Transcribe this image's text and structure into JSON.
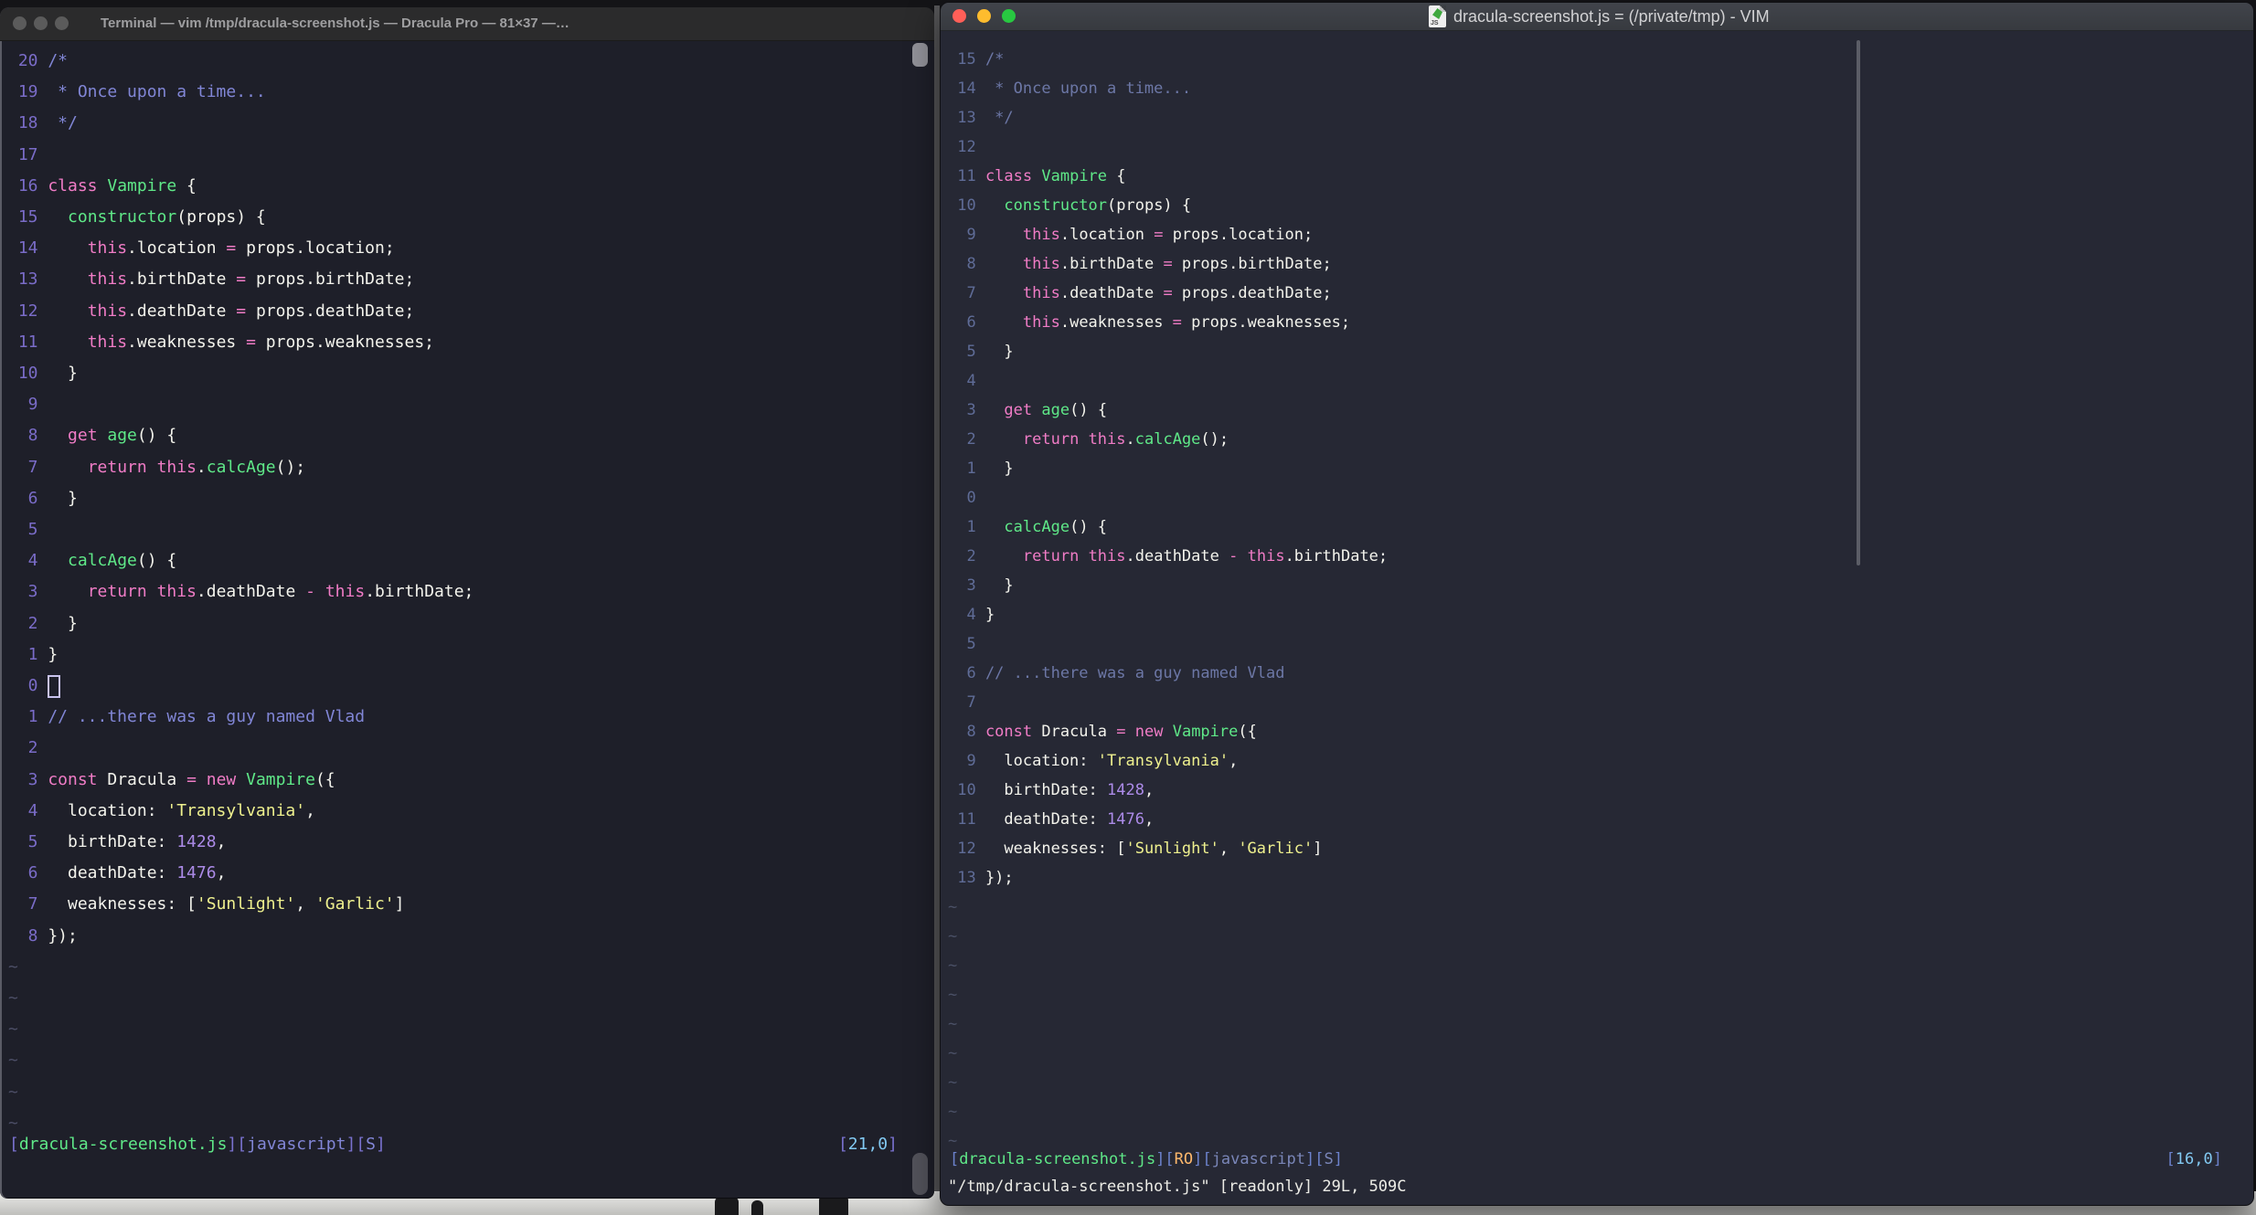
{
  "left_window": {
    "title": "Terminal — vim /tmp/dracula-screenshot.js — Dracula Pro — 81×37 —…",
    "active": false,
    "cursor_rel_index": 20,
    "cursor_position": "21,0",
    "rel_numbers": [
      20,
      19,
      18,
      17,
      16,
      15,
      14,
      13,
      12,
      11,
      10,
      9,
      8,
      7,
      6,
      5,
      4,
      3,
      2,
      1,
      0,
      1,
      2,
      3,
      4,
      5,
      6,
      7,
      8
    ],
    "tilde_count": 6,
    "statusline_segments": [
      [
        "br",
        "["
      ],
      [
        "file",
        "dracula-screenshot.js"
      ],
      [
        "br",
        "]["
      ],
      [
        "label",
        "javascript"
      ],
      [
        "br",
        "]["
      ],
      [
        "label",
        "S"
      ],
      [
        "br",
        "]"
      ]
    ],
    "ruler_segments": [
      [
        "br",
        "["
      ],
      [
        "pos",
        "21,0"
      ],
      [
        "br",
        "]"
      ]
    ]
  },
  "right_window": {
    "title": "dracula-screenshot.js = (/private/tmp) - VIM",
    "icon_label": "JS",
    "active": true,
    "cursor_rel_index": 15,
    "cursor_position": "16,0",
    "rel_numbers": [
      15,
      14,
      13,
      12,
      11,
      10,
      9,
      8,
      7,
      6,
      5,
      4,
      3,
      2,
      1,
      0,
      1,
      2,
      3,
      4,
      5,
      6,
      7,
      8,
      9,
      10,
      11,
      12,
      13
    ],
    "tilde_count": 9,
    "statusline_segments": [
      [
        "br",
        "["
      ],
      [
        "file",
        "dracula-screenshot.js"
      ],
      [
        "br",
        "]["
      ],
      [
        "ro",
        "RO"
      ],
      [
        "br",
        "]["
      ],
      [
        "label",
        "javascript"
      ],
      [
        "br",
        "]["
      ],
      [
        "label",
        "S"
      ],
      [
        "br",
        "]"
      ]
    ],
    "ruler_segments": [
      [
        "br",
        "["
      ],
      [
        "pos",
        "16,0"
      ],
      [
        "br",
        "]"
      ]
    ],
    "message": "\"/tmp/dracula-screenshot.js\" [readonly] 29L, 509C"
  },
  "tilde": "~",
  "code_lines": [
    [
      [
        "c",
        "/*"
      ]
    ],
    [
      [
        "c",
        " * Once upon a time..."
      ]
    ],
    [
      [
        "c",
        " */"
      ]
    ],
    [],
    [
      [
        "p",
        "class"
      ],
      [
        "f",
        " "
      ],
      [
        "g",
        "Vampire"
      ],
      [
        "f",
        " {"
      ]
    ],
    [
      [
        "f",
        "  "
      ],
      [
        "g",
        "constructor"
      ],
      [
        "f",
        "(props) {"
      ]
    ],
    [
      [
        "f",
        "    "
      ],
      [
        "p",
        "this"
      ],
      [
        "f",
        ".location "
      ],
      [
        "p",
        "="
      ],
      [
        "f",
        " props.location;"
      ]
    ],
    [
      [
        "f",
        "    "
      ],
      [
        "p",
        "this"
      ],
      [
        "f",
        ".birthDate "
      ],
      [
        "p",
        "="
      ],
      [
        "f",
        " props.birthDate;"
      ]
    ],
    [
      [
        "f",
        "    "
      ],
      [
        "p",
        "this"
      ],
      [
        "f",
        ".deathDate "
      ],
      [
        "p",
        "="
      ],
      [
        "f",
        " props.deathDate;"
      ]
    ],
    [
      [
        "f",
        "    "
      ],
      [
        "p",
        "this"
      ],
      [
        "f",
        ".weaknesses "
      ],
      [
        "p",
        "="
      ],
      [
        "f",
        " props.weaknesses;"
      ]
    ],
    [
      [
        "f",
        "  }"
      ]
    ],
    [],
    [
      [
        "f",
        "  "
      ],
      [
        "p",
        "get"
      ],
      [
        "f",
        " "
      ],
      [
        "g",
        "age"
      ],
      [
        "f",
        "() {"
      ]
    ],
    [
      [
        "f",
        "    "
      ],
      [
        "p",
        "return"
      ],
      [
        "f",
        " "
      ],
      [
        "p",
        "this"
      ],
      [
        "f",
        "."
      ],
      [
        "g",
        "calcAge"
      ],
      [
        "f",
        "();"
      ]
    ],
    [
      [
        "f",
        "  }"
      ]
    ],
    [],
    [
      [
        "f",
        "  "
      ],
      [
        "g",
        "calcAge"
      ],
      [
        "f",
        "() {"
      ]
    ],
    [
      [
        "f",
        "    "
      ],
      [
        "p",
        "return"
      ],
      [
        "f",
        " "
      ],
      [
        "p",
        "this"
      ],
      [
        "f",
        ".deathDate "
      ],
      [
        "p",
        "-"
      ],
      [
        "f",
        " "
      ],
      [
        "p",
        "this"
      ],
      [
        "f",
        ".birthDate;"
      ]
    ],
    [
      [
        "f",
        "  }"
      ]
    ],
    [
      [
        "f",
        "}"
      ]
    ],
    [],
    [
      [
        "c",
        "// ...there was a guy named Vlad"
      ]
    ],
    [],
    [
      [
        "p",
        "const"
      ],
      [
        "f",
        " Dracula "
      ],
      [
        "p",
        "="
      ],
      [
        "f",
        " "
      ],
      [
        "p",
        "new"
      ],
      [
        "f",
        " "
      ],
      [
        "g",
        "Vampire"
      ],
      [
        "f",
        "({"
      ]
    ],
    [
      [
        "f",
        "  location: "
      ],
      [
        "y",
        "'Transylvania'"
      ],
      [
        "f",
        ","
      ]
    ],
    [
      [
        "f",
        "  birthDate: "
      ],
      [
        "n",
        "1428"
      ],
      [
        "f",
        ","
      ]
    ],
    [
      [
        "f",
        "  deathDate: "
      ],
      [
        "n",
        "1476"
      ],
      [
        "f",
        ","
      ]
    ],
    [
      [
        "f",
        "  weaknesses: ["
      ],
      [
        "y",
        "'Sunlight'"
      ],
      [
        "f",
        ", "
      ],
      [
        "y",
        "'Garlic'"
      ],
      [
        "f",
        "]"
      ]
    ],
    [
      [
        "f",
        "});"
      ]
    ]
  ],
  "colors": {
    "background_left": "#1E1F29",
    "background_right": "#262834",
    "foreground": "#F3F3EC",
    "pink": "#F07CC6",
    "green": "#5FE888",
    "yellow": "#EEF08E",
    "purple_number": "#AC8BE8",
    "comment_left": "#8186D6",
    "comment_right": "#6C77A6",
    "line_number_left": "#7A6CC8",
    "line_number_right": "#5F6C97",
    "ruler_cyan": "#82C9F2",
    "readonly_orange": "#FFB86C"
  }
}
